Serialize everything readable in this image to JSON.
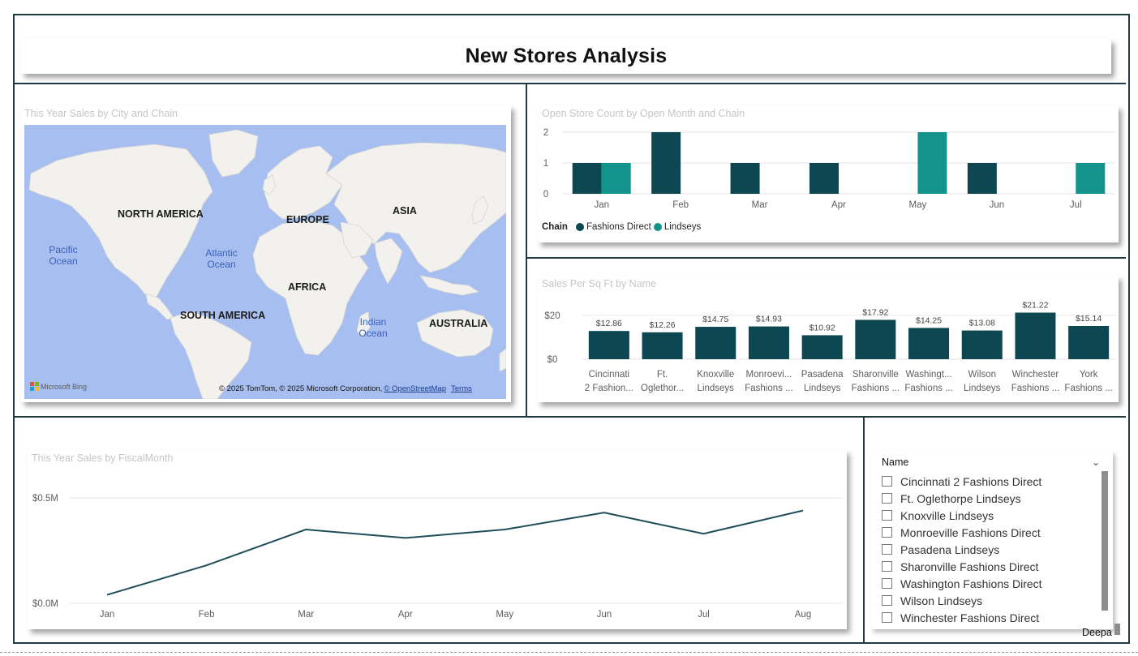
{
  "page": {
    "title": "New Stores Analysis",
    "user_tag": "Deepa"
  },
  "map_visual": {
    "title": "This Year Sales by City and Chain",
    "continents": [
      "NORTH AMERICA",
      "EUROPE",
      "ASIA",
      "AFRICA",
      "SOUTH AMERICA",
      "AUSTRALIA"
    ],
    "oceans": [
      "Pacific Ocean",
      "Atlantic Ocean",
      "Indian Ocean"
    ],
    "bing_label": "Microsoft Bing",
    "copyright": "© 2025 TomTom, © 2025 Microsoft Corporation,",
    "osm_link": "© OpenStreetMap",
    "terms_link": "Terms",
    "colors": {
      "water": "#a6bff0",
      "land": "#f2f1ee"
    }
  },
  "store_count_chart": {
    "title": "Open Store Count by Open Month and Chain",
    "legend_title": "Chain",
    "colors": {
      "Fashions Direct": "#0d4751",
      "Lindseys": "#12948d"
    }
  },
  "sqft_chart": {
    "title": "Sales Per Sq Ft by Name",
    "color": "#0d4751",
    "x_labels": [
      [
        "Cincinnati",
        "2 Fashion..."
      ],
      [
        "Ft.",
        "Oglethor..."
      ],
      [
        "Knoxville",
        "Lindseys"
      ],
      [
        "Monroevi...",
        "Fashions ..."
      ],
      [
        "Pasadena",
        "Lindseys"
      ],
      [
        "Sharonville",
        "Fashions ..."
      ],
      [
        "Washingt...",
        "Fashions ..."
      ],
      [
        "Wilson",
        "Lindseys"
      ],
      [
        "Winchester",
        "Fashions ..."
      ],
      [
        "York",
        "Fashions ..."
      ]
    ],
    "data_labels": [
      "$12.86",
      "$12.26",
      "$14.75",
      "$14.93",
      "$10.92",
      "$17.92",
      "$14.25",
      "$13.08",
      "$21.22",
      "$15.14"
    ]
  },
  "sales_line_chart": {
    "title": "This Year Sales by FiscalMonth",
    "color": "#1f4e5a"
  },
  "slicer": {
    "header": "Name",
    "items": [
      "Cincinnati 2 Fashions Direct",
      "Ft. Oglethorpe Lindseys",
      "Knoxville Lindseys",
      "Monroeville Fashions Direct",
      "Pasadena Lindseys",
      "Sharonville Fashions Direct",
      "Washington Fashions Direct",
      "Wilson Lindseys",
      "Winchester Fashions Direct"
    ]
  },
  "chart_data": [
    {
      "type": "bar",
      "title": "Open Store Count by Open Month and Chain",
      "categories": [
        "Jan",
        "Feb",
        "Mar",
        "Apr",
        "May",
        "Jun",
        "Jul"
      ],
      "series": [
        {
          "name": "Fashions Direct",
          "values": [
            1,
            2,
            1,
            1,
            0,
            1,
            0
          ]
        },
        {
          "name": "Lindseys",
          "values": [
            1,
            0,
            0,
            0,
            2,
            0,
            1
          ]
        }
      ],
      "yticks": [
        "0",
        "1",
        "2"
      ],
      "ylim": [
        0,
        2
      ],
      "legend": "bottom-left",
      "grid": true
    },
    {
      "type": "bar",
      "title": "Sales Per Sq Ft by Name",
      "categories": [
        "Cincinnati 2 Fashions Direct",
        "Ft. Oglethorpe Lindseys",
        "Knoxville Lindseys",
        "Monroeville Fashions Direct",
        "Pasadena Lindseys",
        "Sharonville Fashions Direct",
        "Washington Fashions Direct",
        "Wilson Lindseys",
        "Winchester Fashions Direct",
        "York Fashions Direct"
      ],
      "values": [
        12.86,
        12.26,
        14.75,
        14.93,
        10.92,
        17.92,
        14.25,
        13.08,
        21.22,
        15.14
      ],
      "yticks": [
        "$0",
        "$20"
      ],
      "ylim": [
        0,
        24
      ],
      "grid": true
    },
    {
      "type": "line",
      "title": "This Year Sales by FiscalMonth",
      "categories": [
        "Jan",
        "Feb",
        "Mar",
        "Apr",
        "May",
        "Jun",
        "Jul",
        "Aug"
      ],
      "values": [
        0.04,
        0.18,
        0.35,
        0.31,
        0.35,
        0.43,
        0.33,
        0.44
      ],
      "yticks": [
        "$0.0M",
        "$0.5M"
      ],
      "ylim": [
        0,
        0.5
      ],
      "grid": true
    }
  ]
}
